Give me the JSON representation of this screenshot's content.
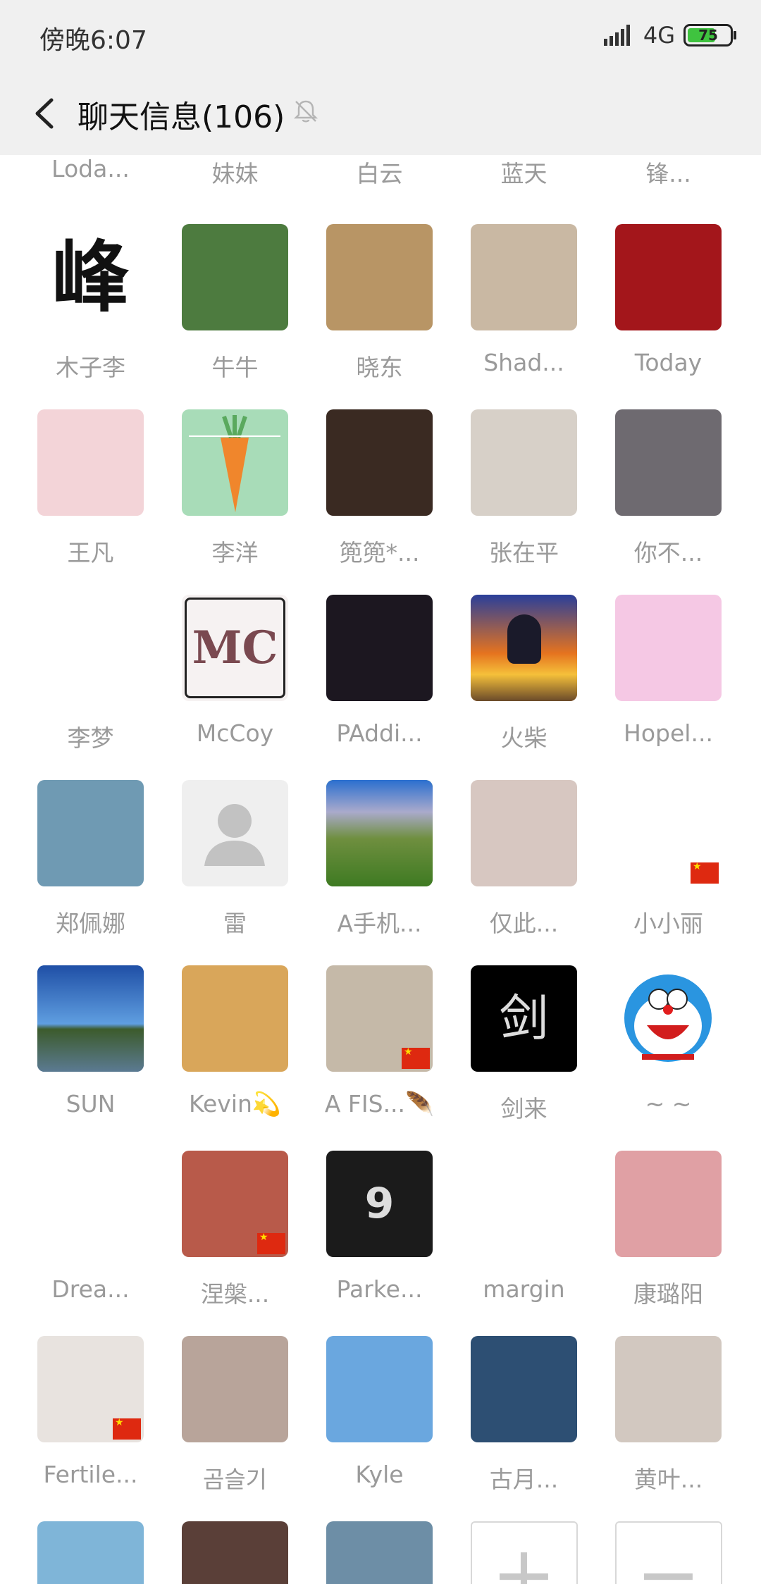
{
  "status": {
    "time": "傍晚6:07",
    "network": "4G",
    "battery": "75",
    "battery_level": 0.75
  },
  "header": {
    "title": "聊天信息(106)"
  },
  "top_names": [
    "Loda...",
    "妹妹",
    "白云",
    "蓝天",
    "锋..."
  ],
  "members": [
    {
      "name": "木子李",
      "icon": "peak-char-avatar",
      "bg": "#ffffff"
    },
    {
      "name": "牛牛",
      "icon": "girl-flower-avatar",
      "bg": "#4d7b3f"
    },
    {
      "name": "晓东",
      "icon": "beach-person-avatar",
      "bg": "#b89565"
    },
    {
      "name": "Shad...",
      "icon": "camera-man-avatar",
      "bg": "#c9b8a3"
    },
    {
      "name": "Today",
      "icon": "cartoon-goat-avatar",
      "bg": "#a3161b"
    },
    {
      "name": "王凡",
      "icon": "girl-bunny-avatar",
      "bg": "#f3d4d8"
    },
    {
      "name": "李洋",
      "icon": "carrot-avatar",
      "bg": "#a8dcb8"
    },
    {
      "name": "篼篼*...",
      "icon": "kids-night-avatar",
      "bg": "#3a2a22"
    },
    {
      "name": "张在平",
      "icon": "man-face-avatar",
      "bg": "#d7d0c8"
    },
    {
      "name": "你不...",
      "icon": "man-portrait-avatar",
      "bg": "#6e6a70"
    },
    {
      "name": "李梦",
      "icon": "sorry-bear-avatar",
      "bg": "#ffffff"
    },
    {
      "name": "McCoy",
      "icon": "mc-monogram-avatar",
      "bg": "#f6f2f2"
    },
    {
      "name": "PAddi...",
      "icon": "city-night-avatar",
      "bg": "#1c1720"
    },
    {
      "name": "火柴",
      "icon": "sunset-silhouette-avatar",
      "bg": "#e5731f"
    },
    {
      "name": "Hopel...",
      "icon": "cartoon-bears-avatar",
      "bg": "#f5c8e4"
    },
    {
      "name": "郑佩娜",
      "icon": "baby-photo-avatar",
      "bg": "#6f9ab3"
    },
    {
      "name": "雷",
      "icon": "default-user-avatar",
      "bg": "#efefef"
    },
    {
      "name": "A手机...",
      "icon": "mountain-meadow-avatar",
      "bg": "#4f8d2f"
    },
    {
      "name": "仅此...",
      "icon": "anime-girl-avatar",
      "bg": "#d7c7c1"
    },
    {
      "name": "小小丽",
      "icon": "cartoon-girl-cat-avatar",
      "bg": "#ffffff"
    },
    {
      "name": "SUN",
      "icon": "lake-sky-avatar",
      "bg": "#2a5fa6"
    },
    {
      "name": "Kevin💫",
      "icon": "shiba-dog-avatar",
      "bg": "#d9a65a"
    },
    {
      "name": "A FIS...🪶",
      "icon": "pink-coat-avatar",
      "bg": "#c5b9a8"
    },
    {
      "name": "剑来",
      "icon": "calligraphy-avatar",
      "bg": "#000000"
    },
    {
      "name": "~ ~",
      "icon": "doraemon-avatar",
      "bg": "#ffffff"
    },
    {
      "name": "Drea...",
      "icon": "husky-avatar",
      "bg": "#ffffff"
    },
    {
      "name": "涅槃...",
      "icon": "couple-red-avatar",
      "bg": "#b85a4a"
    },
    {
      "name": "Parke...",
      "icon": "basketball-9-avatar",
      "bg": "#1b1b1b"
    },
    {
      "name": "margin",
      "icon": "cartoon-boy-avatar",
      "bg": "#ffffff"
    },
    {
      "name": "康璐阳",
      "icon": "hand-closeup-avatar",
      "bg": "#e0a0a4"
    },
    {
      "name": "Fertile...",
      "icon": "man-cap-avatar",
      "bg": "#e8e3df"
    },
    {
      "name": "곰슬기",
      "icon": "girl-cat-avatar",
      "bg": "#b8a49a"
    },
    {
      "name": "Kyle",
      "icon": "blue-sky-person-avatar",
      "bg": "#6aa7df"
    },
    {
      "name": "古月...",
      "icon": "anime-scene-avatar",
      "bg": "#2d4f73"
    },
    {
      "name": "黄叶...",
      "icon": "cats-avatar",
      "bg": "#d2c8c0"
    },
    {
      "name": "",
      "icon": "man-selfie-avatar",
      "bg": "#7fb5d8"
    },
    {
      "name": "",
      "icon": "group-photo-avatar",
      "bg": "#5a3f38"
    },
    {
      "name": "",
      "icon": "sea-landscape-avatar",
      "bg": "#6d8ea6"
    }
  ],
  "actions": {
    "add_label": "+",
    "remove_label": "−"
  }
}
